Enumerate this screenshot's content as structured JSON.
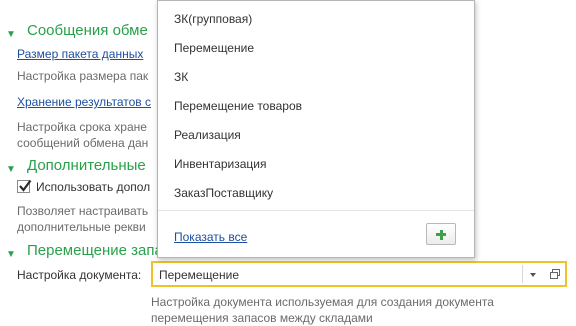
{
  "sections": [
    {
      "title": "Сообщения обме",
      "items": [
        {
          "link": "Размер пакета данных",
          "hint": [
            "Настройка размера пак"
          ]
        },
        {
          "link": "Хранение результатов с",
          "hint": [
            "Настройка срока хране",
            "сообщений обмена дан"
          ]
        }
      ]
    },
    {
      "title": "Дополнительные",
      "checkbox_label": "Использовать допол",
      "checkbox_checked": true,
      "hint": [
        "Позволяет настраивать",
        "дополнительные рекви"
      ]
    },
    {
      "title": "Перемещение запас",
      "field_label": "Настройка документа:",
      "field_value": "Перемещение",
      "hint": [
        "Настройка документа используемая для создания документа",
        "перемещения запасов между складами"
      ]
    }
  ],
  "dropdown": {
    "items": [
      "ЗК(групповая)",
      "Перемещение",
      "ЗК",
      "Перемещение товаров",
      "Реализация",
      "Инвентаризация",
      "ЗаказПоставщику"
    ],
    "show_all": "Показать все"
  }
}
